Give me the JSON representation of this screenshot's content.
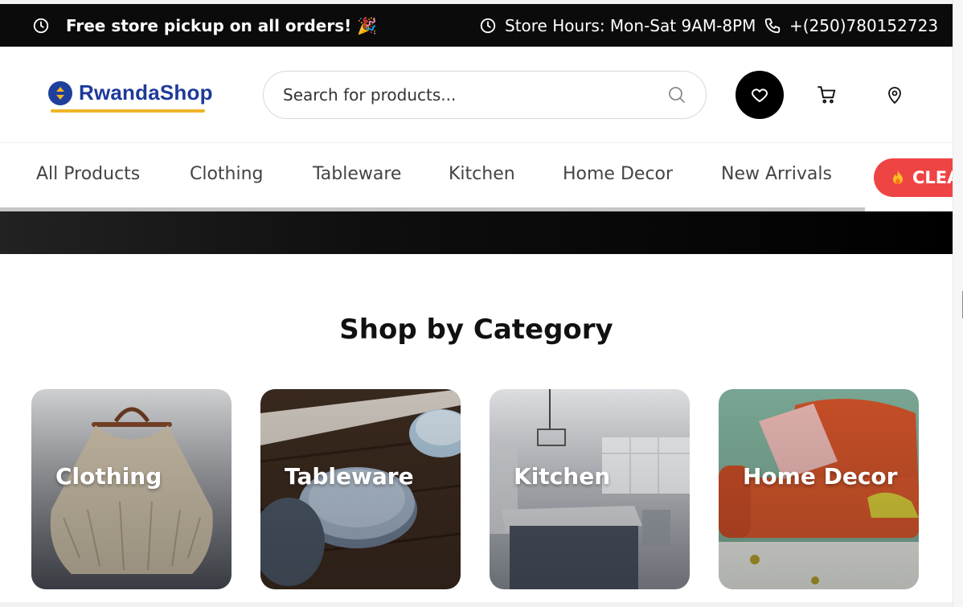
{
  "topbar": {
    "promo": "Free store pickup on all orders! 🎉",
    "hours": "Store Hours: Mon-Sat 9AM-8PM",
    "phone": "+(250)780152723"
  },
  "header": {
    "logo_text": "RwandaShop",
    "search_placeholder": "Search for products..."
  },
  "nav": {
    "items": [
      "All Products",
      "Clothing",
      "Tableware",
      "Kitchen",
      "Home Decor",
      "New Arrivals"
    ],
    "clearance_label": "CLEA"
  },
  "section": {
    "title": "Shop by Category"
  },
  "categories": [
    {
      "label": "Clothing"
    },
    {
      "label": "Tableware"
    },
    {
      "label": "Kitchen"
    },
    {
      "label": "Home Decor"
    }
  ],
  "colors": {
    "topbar_bg": "#0b0b0b",
    "brand_blue": "#1e3a9a",
    "brand_yellow": "#f0b429",
    "clearance_red": "#ef4444"
  }
}
